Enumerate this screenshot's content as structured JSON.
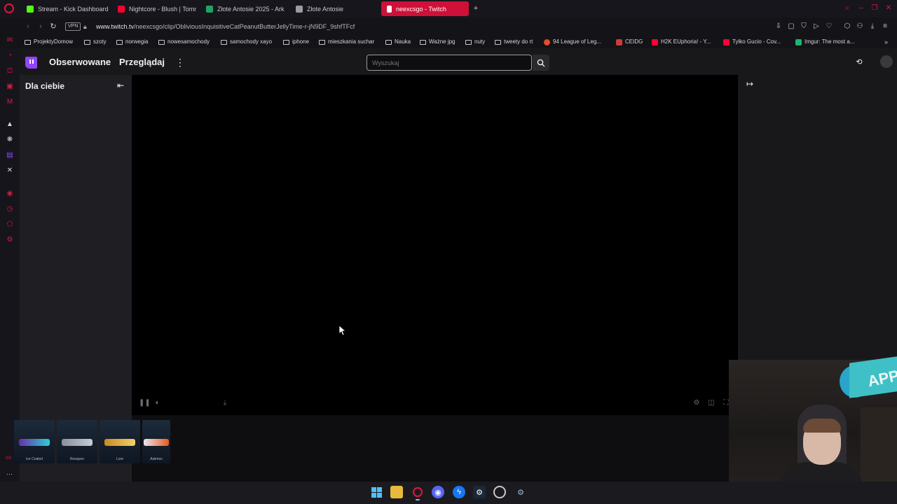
{
  "browser": {
    "tabs": [
      {
        "label": "Stream - Kick Dashboard",
        "favicon_color": "#53fc18"
      },
      {
        "label": "Nightcore - Blush | Tomm",
        "favicon_color": "#ff0033"
      },
      {
        "label": "Złote Antosie 2025 - Ark",
        "favicon_color": "#1fa463"
      },
      {
        "label": "Złote Antosie",
        "favicon_color": "#9b9ba0"
      },
      {
        "label": "neexcsgo - Twitch",
        "favicon_color": "#ffffff",
        "active": true
      }
    ],
    "new_tab": "+",
    "vpn_label": "VPN",
    "url_host": "www.twitch.tv",
    "url_path": "/neexcsgo/clip/ObliviousInquisitiveCatPeanutButterJellyTime-r-jN9DF_9shfTFcf",
    "bookmarks": [
      {
        "label": "ProjektyDomow",
        "type": "folder"
      },
      {
        "label": "szoty",
        "type": "folder"
      },
      {
        "label": "norwegia",
        "type": "folder"
      },
      {
        "label": "nowesamochody",
        "type": "folder"
      },
      {
        "label": "samochody xayo",
        "type": "folder"
      },
      {
        "label": "iphone",
        "type": "folder"
      },
      {
        "label": "mieszkania suchar",
        "type": "folder"
      },
      {
        "label": "Nauka",
        "type": "folder"
      },
      {
        "label": "Ważne jpg",
        "type": "folder"
      },
      {
        "label": "nuty",
        "type": "folder"
      },
      {
        "label": "tweety do rt",
        "type": "folder"
      },
      {
        "label": "94 League of Leg...",
        "type": "site",
        "color": "#e84a2a"
      },
      {
        "label": "CEIDG",
        "type": "site",
        "color": "#d03a3a"
      },
      {
        "label": "H2K EUphoria! - Y...",
        "type": "site",
        "color": "#ff0033"
      },
      {
        "label": "Tylko Gucio - Cov...",
        "type": "site",
        "color": "#ff0033"
      },
      {
        "label": "Imgur: The most a...",
        "type": "site",
        "color": "#1bb76e"
      }
    ]
  },
  "twitch": {
    "nav_following": "Obserwowane",
    "nav_browse": "Przeglądaj",
    "search_placeholder": "Wyszukaj",
    "left_nav_title": "Dla ciebie"
  },
  "overlay": {
    "skins": [
      "Ice Coaled",
      "Resquen",
      "Lore",
      "Asiimov"
    ],
    "banner_text": "APP"
  },
  "colors": {
    "opera_red": "#e0173f",
    "twitch_purple": "#9146ff",
    "active_tab": "#cf1038"
  }
}
